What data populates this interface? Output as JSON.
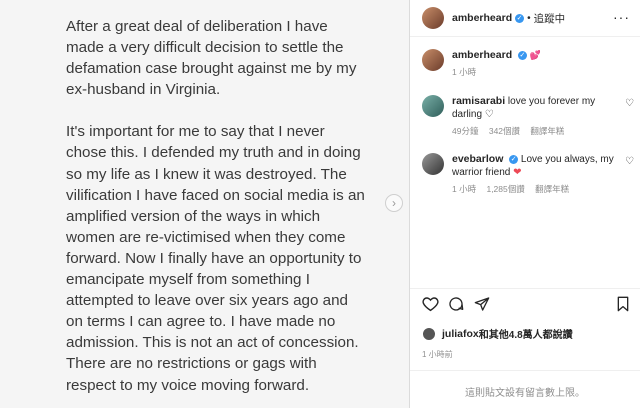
{
  "post": {
    "paragraphs": [
      "After a great deal of deliberation I have made a very difficult decision to settle the defamation case brought against me by my ex-husband in Virginia.",
      "It's important for me to say that I never chose this. I defended my truth and in doing so my life as I knew it was destroyed. The vilification I have faced on social media is an amplified version of the ways in which women are re-victimised when they come forward.  Now I finally have an opportunity to emancipate myself from something I attempted to leave over six years ago and on terms I can agree to. I have made no admission. This is not an act of concession. There are no restrictions or gags with respect to my voice moving forward."
    ],
    "next_icon": "chevron-right-icon"
  },
  "header": {
    "username": "amberheard",
    "separator": "•",
    "follow_status": "追蹤中",
    "more_icon": "more-horizontal-icon",
    "more_glyph": "···"
  },
  "caption": {
    "username": "amberheard",
    "emoji": "💕",
    "time": "1 小時"
  },
  "comments": [
    {
      "username": "ramisarabi",
      "text": "love you forever my darling ♡",
      "time": "49分鐘",
      "likes": "342個讚",
      "action": "翻譯年糕",
      "verified": false
    },
    {
      "username": "evebarlow",
      "text": "Love you always, my warrior friend",
      "heart": "❤",
      "time": "1 小時",
      "likes": "1,285個讚",
      "action": "翻譯年糕",
      "verified": true
    }
  ],
  "likes": {
    "user": "juliafox",
    "suffix": "和其他4.8萬人都說讚"
  },
  "post_time": "1 小時前",
  "comments_disabled": "這則貼文設有留言數上限。"
}
